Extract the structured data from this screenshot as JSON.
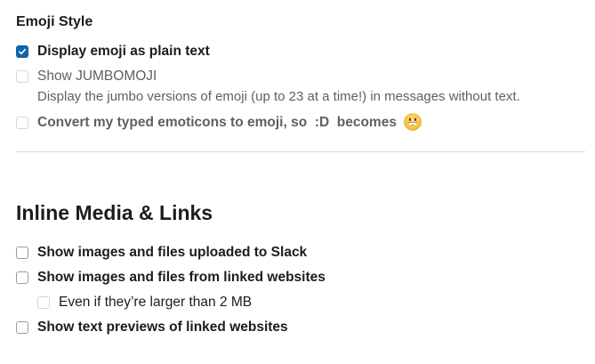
{
  "emoji_style": {
    "heading": "Emoji Style",
    "display_plain_text": {
      "label": "Display emoji as plain text",
      "checked": true
    },
    "jumbomoji": {
      "label": "Show JUMBOMOJI",
      "checked": false,
      "enabled": false,
      "hint": "Display the jumbo versions of emoji (up to 23 at a time!) in messages without text."
    },
    "convert_emoticons": {
      "label_prefix": "Convert my typed emoticons to emoji, so  :D  becomes",
      "checked": false,
      "enabled": false,
      "emoji_icon": "grinning-face-icon"
    }
  },
  "inline_media": {
    "heading": "Inline Media & Links",
    "options": [
      {
        "label": "Show images and files uploaded to Slack",
        "checked": false
      },
      {
        "label": "Show images and files from linked websites",
        "checked": false
      },
      {
        "label": "Even if they’re larger than 2 MB",
        "checked": false,
        "enabled": false
      },
      {
        "label": "Show text previews of linked websites",
        "checked": false
      }
    ]
  },
  "colors": {
    "accent": "#1264a3",
    "text": "#1d1c1d",
    "muted": "#616061",
    "divider": "#dddddd"
  }
}
